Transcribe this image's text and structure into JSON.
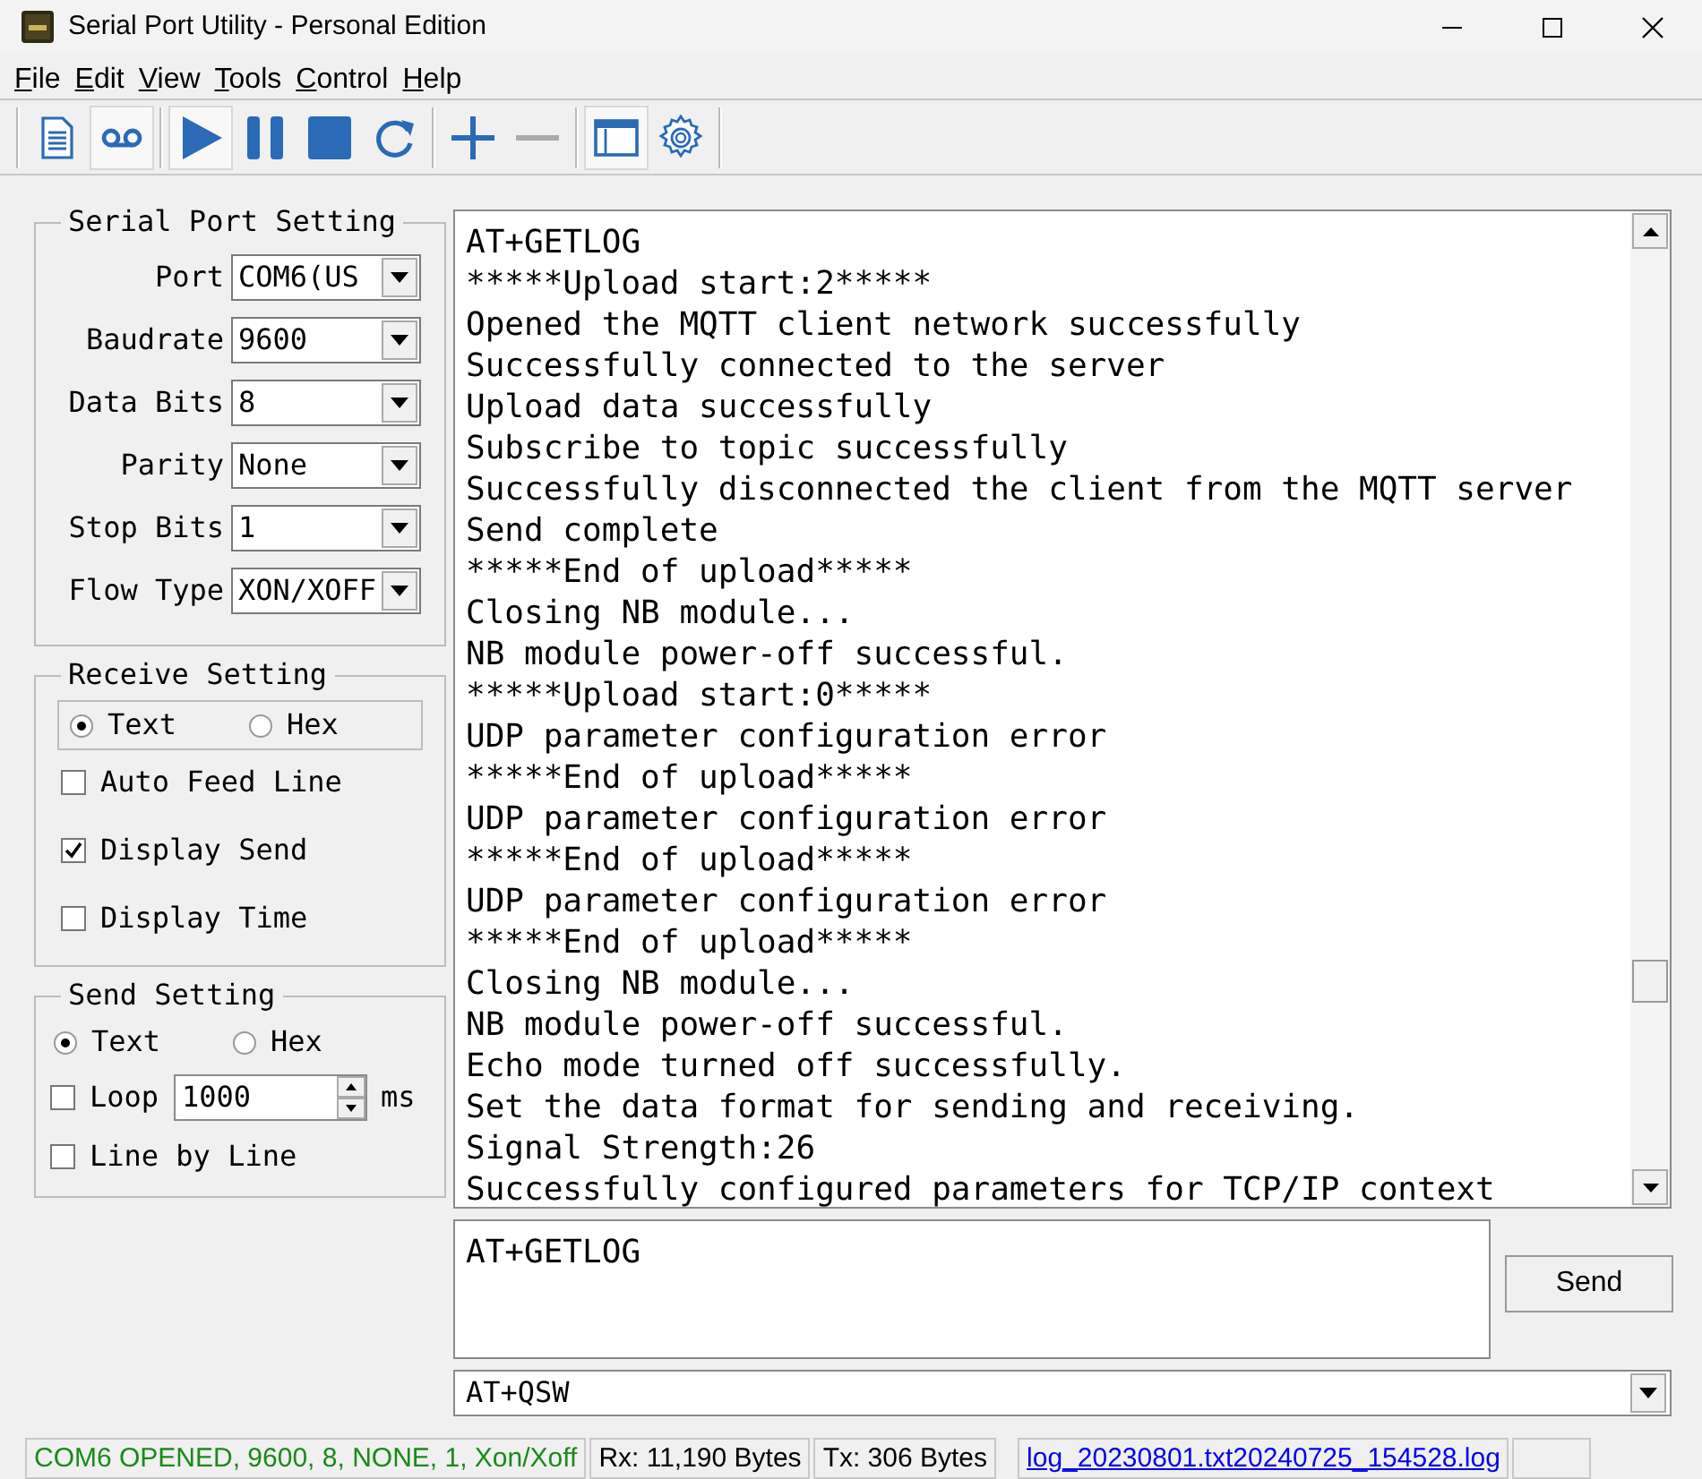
{
  "window": {
    "title": "Serial Port Utility - Personal Edition"
  },
  "menu": [
    {
      "label": "File"
    },
    {
      "label": "Edit"
    },
    {
      "label": "View"
    },
    {
      "label": "Tools"
    },
    {
      "label": "Control"
    },
    {
      "label": "Help"
    }
  ],
  "toolbar": [
    {
      "kind": "document",
      "pressed": false
    },
    {
      "kind": "tape",
      "pressed": true
    },
    {
      "kind": "play",
      "pressed": true
    },
    {
      "kind": "pause",
      "pressed": false
    },
    {
      "kind": "stop",
      "pressed": false
    },
    {
      "kind": "refresh",
      "pressed": false
    },
    {
      "kind": "plus",
      "pressed": false
    },
    {
      "kind": "minus",
      "pressed": false
    },
    {
      "kind": "window",
      "pressed": true
    },
    {
      "kind": "gear",
      "pressed": false
    }
  ],
  "serial_port_setting": {
    "title": "Serial Port Setting",
    "fields": [
      {
        "label": "Port",
        "value": "COM6(US"
      },
      {
        "label": "Baudrate",
        "value": "9600"
      },
      {
        "label": "Data Bits",
        "value": "8"
      },
      {
        "label": "Parity",
        "value": "None"
      },
      {
        "label": "Stop Bits",
        "value": "1"
      },
      {
        "label": "Flow Type",
        "value": "XON/XOFF"
      }
    ]
  },
  "receive_setting": {
    "title": "Receive Setting",
    "modes": [
      {
        "label": "Text",
        "selected": true
      },
      {
        "label": "Hex",
        "selected": false
      }
    ],
    "options": [
      {
        "label": "Auto Feed Line",
        "checked": false
      },
      {
        "label": "Display Send",
        "checked": true
      },
      {
        "label": "Display Time",
        "checked": false
      }
    ]
  },
  "send_setting": {
    "title": "Send Setting",
    "modes": [
      {
        "label": "Text",
        "selected": true
      },
      {
        "label": "Hex",
        "selected": false
      }
    ],
    "loop": {
      "label": "Loop",
      "checked": false,
      "value": "1000",
      "unit": "ms"
    },
    "line_by_line": {
      "label": "Line by Line",
      "checked": false
    }
  },
  "log": {
    "lines": [
      "AT+GETLOG",
      "*****Upload start:2*****",
      "Opened the MQTT client network successfully",
      "Successfully connected to the server",
      "Upload data successfully",
      "Subscribe to topic successfully",
      "Successfully disconnected the client from the MQTT server",
      "Send complete",
      "*****End of upload*****",
      "Closing NB module...",
      "NB module power-off successful.",
      "*****Upload start:0*****",
      "UDP parameter configuration error",
      "*****End of upload*****",
      "UDP parameter configuration error",
      "*****End of upload*****",
      "UDP parameter configuration error",
      "*****End of upload*****",
      "Closing NB module...",
      "NB module power-off successful.",
      "Echo mode turned off successfully.",
      "Set the data format for sending and receiving.",
      "Signal Strength:26",
      "Successfully configured parameters for TCP/IP context"
    ]
  },
  "send_input": {
    "value": "AT+GETLOG"
  },
  "send_button": {
    "label": "Send"
  },
  "command_combo": {
    "value": "AT+QSW"
  },
  "status_bar": [
    {
      "kind": "port",
      "text": "COM6 OPENED, 9600, 8, NONE, 1, Xon/Xoff"
    },
    {
      "kind": "text",
      "text": "Rx: 11,190 Bytes"
    },
    {
      "kind": "text",
      "text": "Tx: 306 Bytes"
    },
    {
      "kind": "link",
      "text": "log_20230801.txt20240725_154528.log"
    }
  ]
}
